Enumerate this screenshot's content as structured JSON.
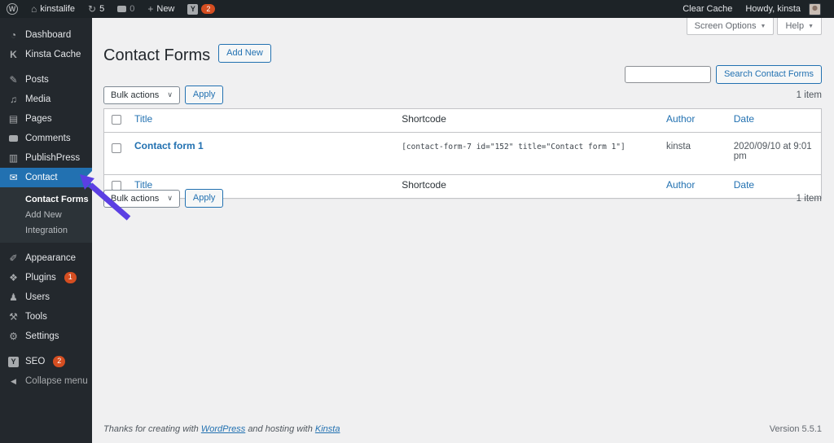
{
  "admin_bar": {
    "wp_logo": "W",
    "home_icon": "⌂",
    "site_name": "kinstalife",
    "updates_icon": "↻",
    "updates_count": "5",
    "comments_count": "0",
    "plus_icon": "+",
    "new_label": "New",
    "seo_icon_letter": "Y",
    "seo_badge": "2",
    "clear_cache": "Clear Cache",
    "howdy": "Howdy, kinsta"
  },
  "icons": {
    "dashboard": "◔",
    "kinsta_cache": "K",
    "posts": "✎",
    "media": "♫",
    "pages": "▤",
    "comments": "speech-bubble (CSS shape)",
    "publishpress": "▥",
    "contact": "✉",
    "appearance": "✐",
    "plugins": "❖",
    "users": "♟",
    "tools": "⚒",
    "settings": "⚙",
    "seo": "Y",
    "collapse": "◀"
  },
  "sidebar": {
    "items": [
      {
        "label": "Dashboard"
      },
      {
        "label": "Kinsta Cache"
      },
      {
        "label": "Posts"
      },
      {
        "label": "Media"
      },
      {
        "label": "Pages"
      },
      {
        "label": "Comments"
      },
      {
        "label": "PublishPress"
      },
      {
        "label": "Contact"
      },
      {
        "label": "Appearance"
      },
      {
        "label": "Plugins",
        "badge": "1"
      },
      {
        "label": "Users"
      },
      {
        "label": "Tools"
      },
      {
        "label": "Settings"
      },
      {
        "label": "SEO",
        "badge": "2"
      }
    ],
    "contact_submenu": [
      {
        "label": "Contact Forms",
        "current": true
      },
      {
        "label": "Add New"
      },
      {
        "label": "Integration"
      }
    ],
    "collapse_label": "Collapse menu"
  },
  "header": {
    "title": "Contact Forms",
    "add_new": "Add New",
    "screen_options": "Screen Options",
    "help": "Help"
  },
  "search": {
    "value": "",
    "button": "Search Contact Forms"
  },
  "toolbar": {
    "bulk_actions": "Bulk actions",
    "apply": "Apply",
    "count_label": "1 item"
  },
  "table": {
    "columns": {
      "title": "Title",
      "shortcode": "Shortcode",
      "author": "Author",
      "date": "Date"
    },
    "rows": [
      {
        "title": "Contact form 1",
        "shortcode": "[contact-form-7 id=\"152\" title=\"Contact form 1\"]",
        "author": "kinsta",
        "date": "2020/09/10 at 9:01 pm"
      }
    ]
  },
  "footer": {
    "thanks_prefix": "Thanks for creating with",
    "wordpress_link": "WordPress",
    "thanks_middle": "and hosting with",
    "kinsta_link": "Kinsta",
    "version": "Version 5.5.1"
  },
  "colors": {
    "accent_blue": "#2271b1",
    "badge_orange": "#d54e21",
    "annotation_arrow": "#5b3fe3",
    "admin_dark": "#1d2327",
    "sidebar_dark": "#23282d",
    "submenu_dark": "#2c3338"
  }
}
